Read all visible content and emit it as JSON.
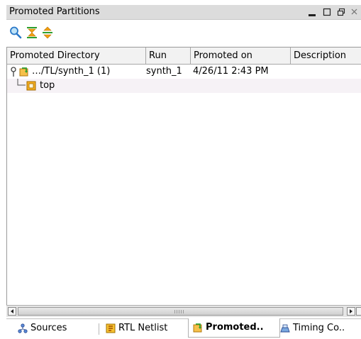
{
  "window": {
    "title": "Promoted Partitions",
    "minimize_glyph": "▁",
    "maximize_glyph": "☐",
    "restore_glyph": "❐",
    "close_glyph": "×"
  },
  "toolbar": {
    "icons": [
      "search-icon",
      "collapse-all-icon",
      "expand-all-icon"
    ]
  },
  "table": {
    "columns": [
      "Promoted Directory",
      "Run",
      "Promoted on",
      "Description"
    ],
    "rows": [
      {
        "directory": "…/TL/synth_1 (1)",
        "run": "synth_1",
        "promoted_on": "4/26/11 2:43 PM",
        "description": "",
        "expanded": true
      },
      {
        "directory": "top",
        "run": "",
        "promoted_on": "",
        "description": ""
      }
    ]
  },
  "tabs": [
    {
      "label": "Sources",
      "icon": "sources-icon",
      "active": false
    },
    {
      "label": "RTL Netlist",
      "icon": "rtl-netlist-icon",
      "active": false
    },
    {
      "label": "Promoted..",
      "icon": "promoted-icon",
      "active": true
    },
    {
      "label": "Timing Co..",
      "icon": "timing-icon",
      "active": false
    }
  ],
  "colors": {
    "titlebar_bg": "#dcdcdc",
    "header_bg": "#f2f2f2",
    "row_alt_bg": "#f6f2f6",
    "accent_orange": "#f0a010",
    "accent_green": "#2fa030"
  }
}
